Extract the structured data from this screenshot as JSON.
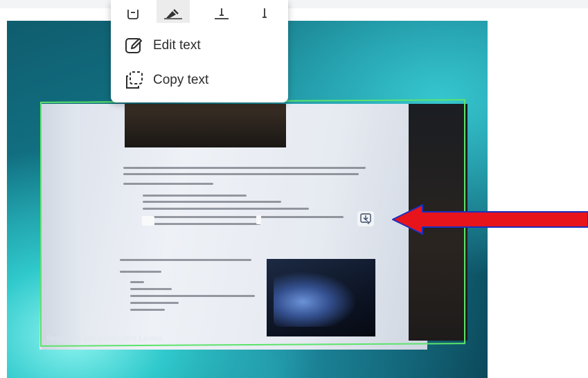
{
  "context_menu": {
    "tools": [
      {
        "icon": "select-box-icon"
      },
      {
        "icon": "highlighter-icon"
      },
      {
        "icon": "underline-icon"
      },
      {
        "icon": "text-cursor-icon"
      }
    ],
    "items": [
      {
        "label": "Edit text",
        "icon": "edit-text-icon"
      },
      {
        "label": "Copy text",
        "icon": "copy-text-icon"
      }
    ]
  },
  "image": {
    "watermark": "Bergen W. van Universiteit Leiden"
  },
  "overlay": {
    "download_icon": "download-icon",
    "arrow_icon": "red-arrow-left-icon"
  },
  "colors": {
    "selection_border": "#5ce36b",
    "arrow": "#e8141c",
    "menu_bg": "#ffffff"
  }
}
